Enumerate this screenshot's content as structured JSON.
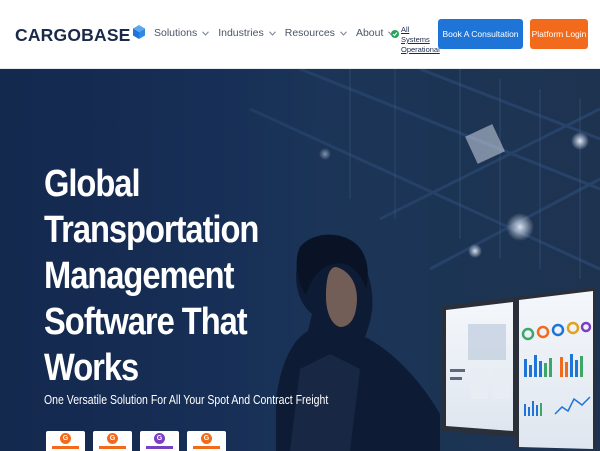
{
  "brand": {
    "name": "CARGOBASE"
  },
  "nav": {
    "items": [
      {
        "label": "Solutions"
      },
      {
        "label": "Industries"
      },
      {
        "label": "Resources"
      },
      {
        "label": "About"
      }
    ]
  },
  "status": {
    "line1": "All Systems",
    "line2": "Operational",
    "color": "#22a55a"
  },
  "buttons": {
    "consultation": "Book A Consultation",
    "login": "Platform Login"
  },
  "hero": {
    "title_lines": [
      "Global",
      "Transportation",
      "Management",
      "Software That",
      "Works"
    ],
    "subtitle": "One Versatile Solution For All Your Spot And Contract Freight"
  },
  "badges": [
    {
      "icon": "g2-badge-icon",
      "color": "#f26a1b"
    },
    {
      "icon": "g2-badge-icon",
      "color": "#f26a1b"
    },
    {
      "icon": "g2-badge-icon",
      "color": "#7b3fc2"
    },
    {
      "icon": "g2-badge-icon",
      "color": "#f26a1b"
    }
  ],
  "colors": {
    "brand_dark": "#1b2a4a",
    "primary_blue": "#1f74d8",
    "accent_orange": "#f26a1b",
    "hero_bg": "#19335c"
  }
}
